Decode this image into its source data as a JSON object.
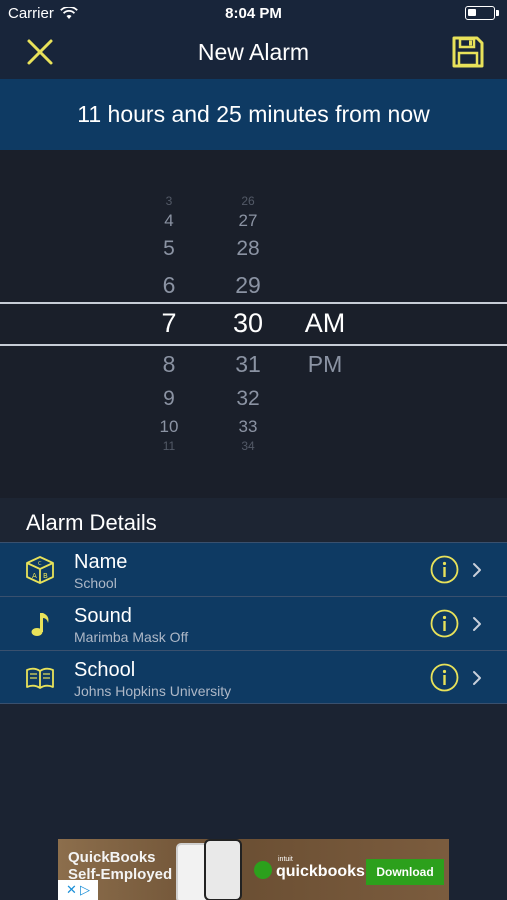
{
  "status_bar": {
    "carrier": "Carrier",
    "time": "8:04 PM"
  },
  "nav": {
    "title": "New Alarm",
    "close_icon": "close-x-icon",
    "save_icon": "floppy-disk-icon"
  },
  "banner": {
    "text": "11 hours and 25 minutes from now"
  },
  "picker": {
    "hours": [
      "3",
      "4",
      "5",
      "6",
      "7",
      "8",
      "9",
      "10",
      "11"
    ],
    "minutes": [
      "26",
      "27",
      "28",
      "29",
      "30",
      "31",
      "32",
      "33",
      "34"
    ],
    "periods": [
      "AM",
      "PM"
    ],
    "selected": {
      "hour": "7",
      "minute": "30",
      "period": "AM"
    }
  },
  "details": {
    "header": "Alarm Details",
    "items": [
      {
        "title": "Name",
        "subtitle": "School",
        "icon": "abc-cube-icon"
      },
      {
        "title": "Sound",
        "subtitle": "Marimba Mask Off",
        "icon": "music-note-icon"
      },
      {
        "title": "School",
        "subtitle": "Johns Hopkins University",
        "icon": "open-book-icon"
      }
    ]
  },
  "ad": {
    "headline_line1": "QuickBooks",
    "headline_line2": "Self-Employed",
    "brand_small": "intuit",
    "brand": "quickbooks",
    "cta": "Download"
  },
  "colors": {
    "accent": "#e8e25a",
    "banner": "#0e3a63",
    "background": "#1b2332"
  }
}
